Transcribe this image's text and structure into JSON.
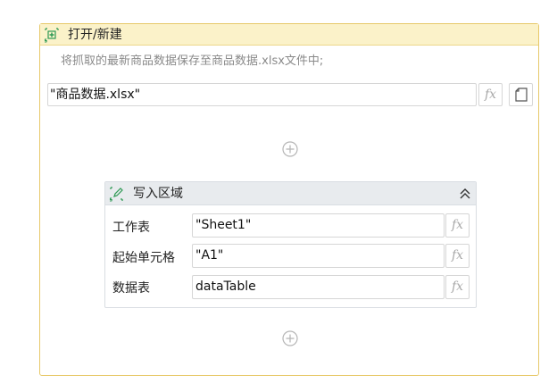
{
  "open_create_block": {
    "title": "打开/新建",
    "description": "将抓取的最新商品数据保存至商品数据.xlsx文件中;",
    "file_path_value": "\"商品数据.xlsx\"",
    "fx_label": "fx"
  },
  "write_range_block": {
    "title": "写入区域",
    "fx_label": "fx",
    "rows": [
      {
        "label": "工作表",
        "value": "\"Sheet1\""
      },
      {
        "label": "起始单元格",
        "value": "\"A1\""
      },
      {
        "label": "数据表",
        "value": "dataTable"
      }
    ]
  },
  "icons": {
    "open_create": "excel-plus-icon",
    "write_range": "excel-edit-icon",
    "collapse": "double-chevron-up-icon",
    "file_browse": "file-icon",
    "add_step": "plus-circle-icon"
  },
  "colors": {
    "header_bg": "#fbf2c9",
    "header_border": "#e7c96a",
    "inner_header_bg": "#e8ebee",
    "excel_green": "#2f9a55"
  }
}
